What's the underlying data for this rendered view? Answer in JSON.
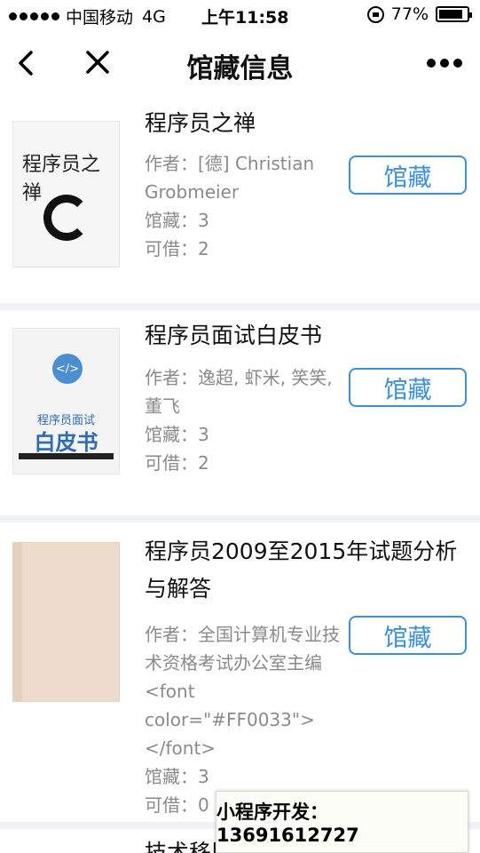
{
  "status_bar": {
    "carrier": "中国移动",
    "network": "4G",
    "time": "上午11:58",
    "battery": "77%"
  },
  "nav": {
    "title": "馆藏信息"
  },
  "books": [
    {
      "title": "程序员之禅",
      "author": "作者：[德] Christian Grobmeier",
      "holdings": "馆藏：3",
      "available": "可借：2",
      "button": "馆藏",
      "cover": {
        "main": "程序员之禅"
      }
    },
    {
      "title": "程序员面试白皮书",
      "author": "作者：逸超, 虾米, 笑笑, 董飞",
      "holdings": "馆藏：3",
      "available": "可借：2",
      "button": "馆藏",
      "cover": {
        "symbol": "</>",
        "line1": "程序员面试",
        "line2": "白皮书"
      }
    },
    {
      "title": "程序员2009至2015年试题分析与解答",
      "author": "作者：全国计算机专业技术资格考试办公室主编 <font color=\"#FF0033\"></font>",
      "holdings": "馆藏：3",
      "available": "可借：0",
      "button": "馆藏"
    },
    {
      "title": "技术移民回忆：程序员海外求职"
    }
  ],
  "dev_badge": "小程序开发：13691612727"
}
